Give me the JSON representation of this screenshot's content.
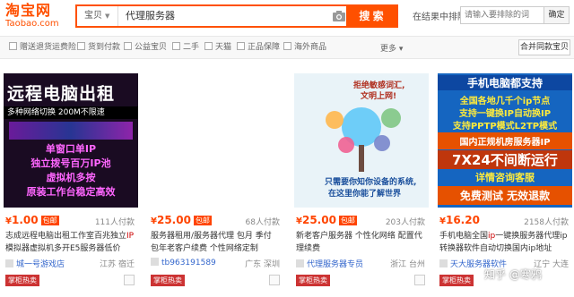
{
  "logo": {
    "cn": "淘宝网",
    "en": "Taobao.com"
  },
  "search": {
    "category": "宝贝",
    "query": "代理服务器",
    "button": "搜 索"
  },
  "in_result": {
    "label": "在结果中排除",
    "placeholder": "请输入要排除的词",
    "button": "确定"
  },
  "filters": [
    "赠送退货运费险",
    "货到付款",
    "公益宝贝",
    "二手",
    "天猫",
    "正品保障",
    "海外商品"
  ],
  "more": "更多",
  "merge": "合并同款宝贝",
  "items": [
    {
      "price": "1.00",
      "tag": "包邮",
      "pay": "111人付款",
      "title_pre": "志成远程电脑出租工作室百兆独立",
      "title_hl": "IP",
      "title_post": "模拟器虚拟机多开E5服务器低价",
      "shop": "城一号游戏店",
      "loc": "江苏 宿迁",
      "badge": "掌柜热卖",
      "img": {
        "l1": "远程电脑出租",
        "l2": "多种网络切换  200M不限速",
        "l3": "单窗口单IP",
        "l4": "独立拨号百万IP池",
        "l5": "虚拟机多按",
        "l6": "原装工作台稳定高效"
      }
    },
    {
      "price": "25.00",
      "tag": "包邮",
      "pay": "68人付款",
      "title_pre": "服务器租用/服务器代理 包月 季付 包年老客户续费 个性网络定制",
      "title_hl": "",
      "title_post": "",
      "shop": "tb963191589",
      "loc": "广东 深圳",
      "badge": "掌柜热卖"
    },
    {
      "price": "25.00",
      "tag": "包邮",
      "pay": "203人付款",
      "title_pre": "新老客户服务器 个性化网络 配置代理续费",
      "title_hl": "",
      "title_post": "",
      "shop": "代理服务器专员",
      "loc": "浙江 台州",
      "badge": "掌柜热卖",
      "img": {
        "t1": "拒绝敏感词汇,",
        "t2": "文明上网!",
        "b1": "只需要你知你设备的系统,",
        "b2": "在这里你能了解世界"
      }
    },
    {
      "price": "16.20",
      "tag": "",
      "pay": "2158人付款",
      "title_pre": "手机电脑全国",
      "title_hl": "ip",
      "title_post": "一键换服务器代理ip转换器软件自动切换国内ip地址",
      "shop": "天大服务器软件",
      "loc": "辽宁 大连",
      "badge": "掌柜热卖",
      "img": {
        "h1": "手机电脑都支持",
        "h2": "全国各地几千个ip节点",
        "h3": "支持一键换IP自动换IP",
        "h4": "支持PPTP模式L2TP模式",
        "h5": "国内正规机房服务器IP",
        "h6": "7X24不间断运行",
        "h7": "详情咨询客服",
        "h8": "免费测试  无效退款"
      }
    }
  ],
  "watermark": "知乎 @寒鸦"
}
